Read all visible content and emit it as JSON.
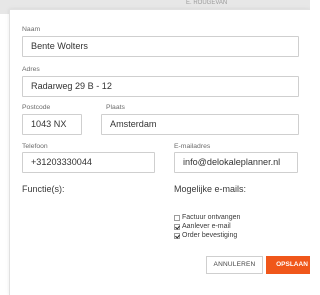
{
  "backdrop": {
    "text": "E. ROUGEVAN"
  },
  "form": {
    "name": {
      "label": "Naam",
      "value": "Bente Wolters"
    },
    "address": {
      "label": "Adres",
      "value": "Radarweg 29 B - 12"
    },
    "postcode": {
      "label": "Postcode",
      "value": "1043 NX"
    },
    "city": {
      "label": "Plaats",
      "value": "Amsterdam"
    },
    "phone": {
      "label": "Telefoon",
      "value": "+31203330044"
    },
    "email": {
      "label": "E-mailadres",
      "value": "info@delokaleplanner.nl"
    },
    "functions": {
      "title": "Functie(s):"
    },
    "possible_emails": {
      "title": "Mogelijke e-mails:",
      "items": [
        {
          "label": "Factuur ontvangen",
          "checked": false
        },
        {
          "label": "Aanlever e-mail",
          "checked": true
        },
        {
          "label": "Order bevestiging",
          "checked": true
        }
      ]
    }
  },
  "actions": {
    "cancel_label": "ANNULEREN",
    "save_label": "OPSLAAN"
  },
  "colors": {
    "accent": "#f0571a",
    "border": "#cfcfcf",
    "text": "#333333"
  }
}
